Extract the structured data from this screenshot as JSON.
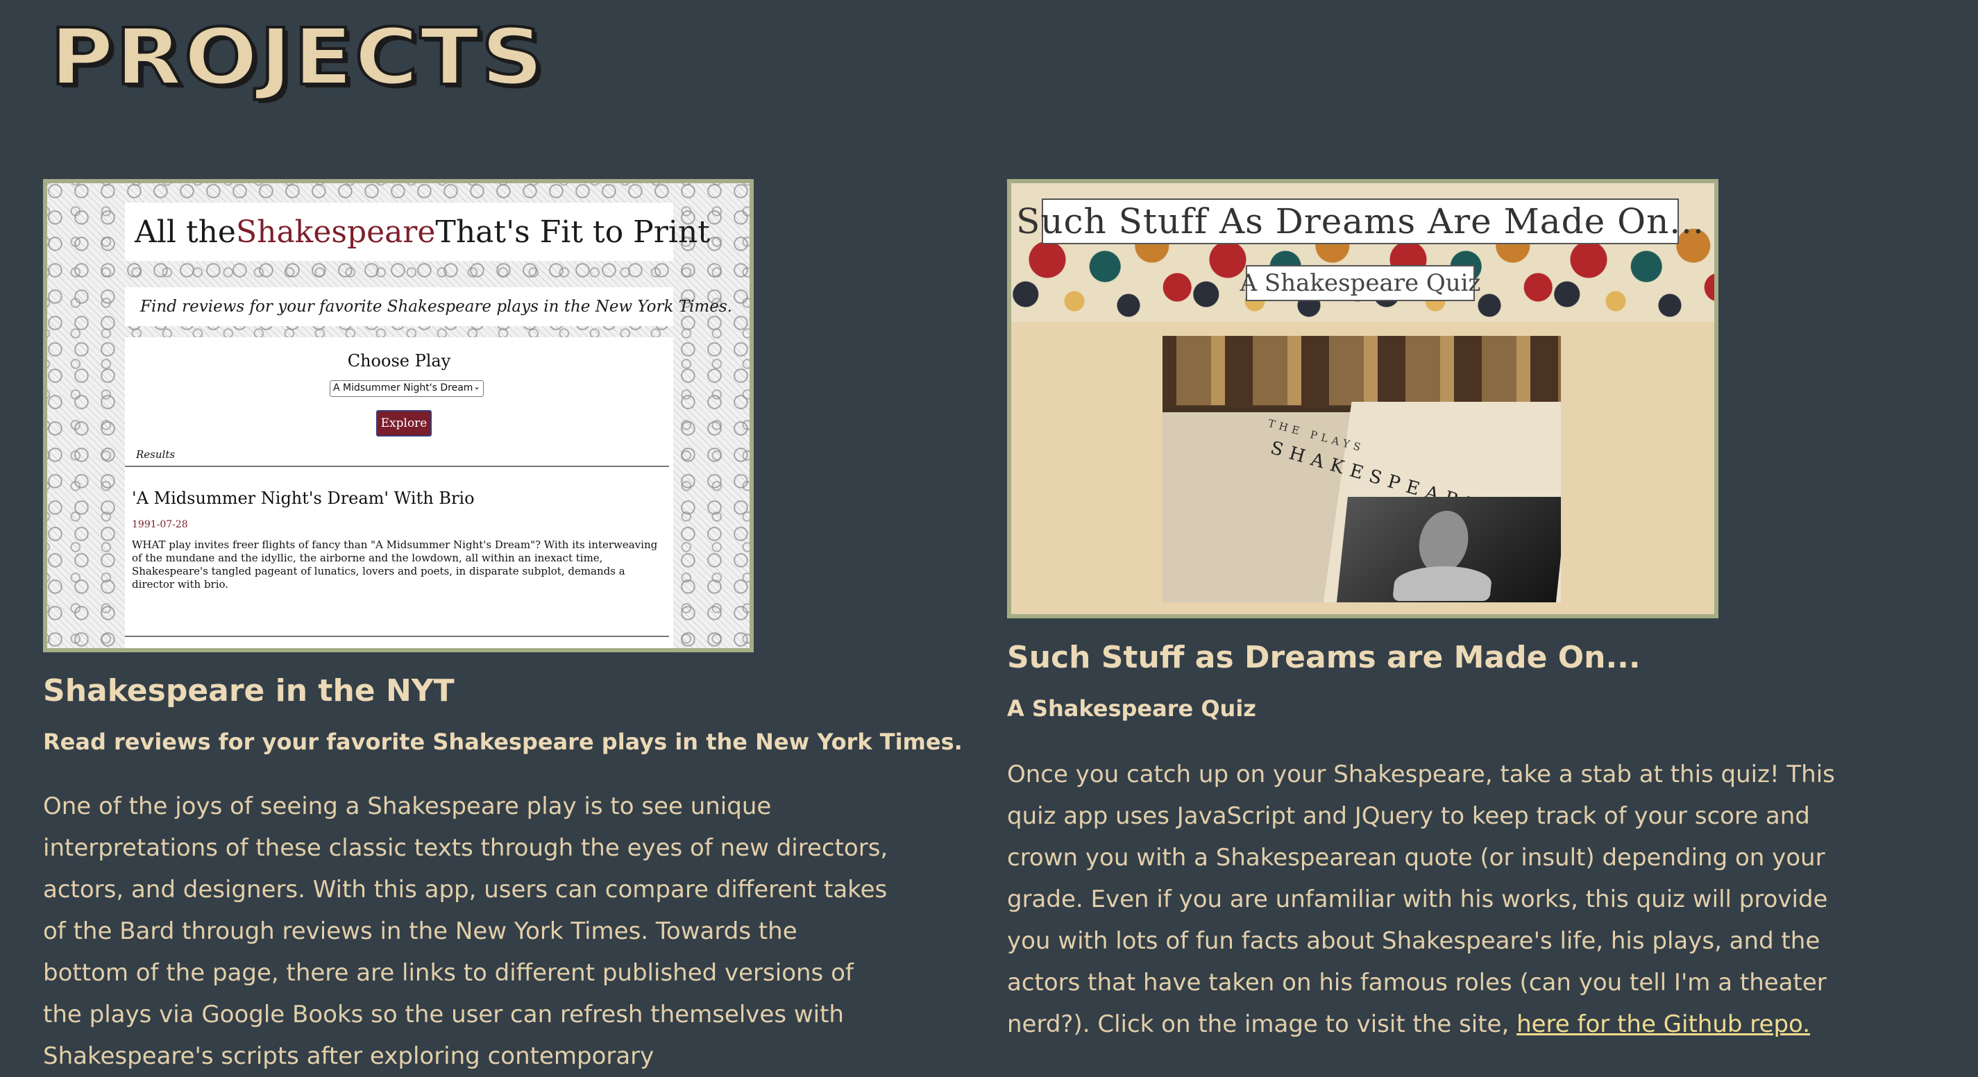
{
  "page": {
    "title": "PROJECTS"
  },
  "projects": [
    {
      "title": "Shakespeare in the NYT",
      "subtitle": "Read reviews for your favorite Shakespeare plays in the New York Times.",
      "description": "One of the joys of seeing a Shakespeare play is to see unique interpretations of these classic texts through the eyes of new directors, actors, and designers. With this app, users can compare different takes of the Bard through reviews in the New York Times. Towards the bottom of the page, there are links to different published versions of the plays via Google Books so the user can refresh themselves with Shakespeare's scripts after exploring contemporary",
      "screenshot": {
        "heading_pre": "All the ",
        "heading_highlight": "Shakespeare",
        "heading_post": " That's Fit to Print",
        "tagline": "Find reviews for your favorite Shakespeare plays in the New York Times.",
        "choose_label": "Choose Play",
        "select_value": "A Midsummer Night's Dream",
        "explore_label": "Explore",
        "results_label": "Results",
        "article_title": "'A Midsummer Night's Dream' With Brio",
        "article_date": "1991-07-28",
        "article_body": "WHAT play invites freer flights of fancy than \"A Midsummer Night's Dream\"? With its interweaving of the mundane and the idyllic, the airborne and the lowdown, all within an inexact time, Shakespeare's tangled pageant of lunatics, lovers and poets, in disparate subplot, demands a director with brio."
      }
    },
    {
      "title": "Such Stuff as Dreams are Made On...",
      "subtitle": "A Shakespeare Quiz",
      "description": "Once you catch up on your Shakespeare, take a stab at this quiz! This quiz app uses JavaScript and JQuery to keep track of your score and crown you with a Shakespearean quote (or insult) depending on your grade. Even if you are unfamiliar with his works, this quiz will provide you with lots of fun facts about Shakespeare's life, his plays, and the actors that have taken on his famous roles (can you tell I'm a theater nerd?). Click on the image to visit the site, ",
      "link_text": "here for the Github repo.",
      "screenshot": {
        "title": "Such Stuff As Dreams Are Made On...",
        "subtitle": "A Shakespeare Quiz",
        "book_line1": "THE PLAYS",
        "book_line2": "SHAKESPEARE"
      }
    }
  ],
  "colors": {
    "background": "#343f48",
    "text": "#e8d6b3",
    "border": "#a6ad86",
    "link": "#f1dc8f"
  }
}
